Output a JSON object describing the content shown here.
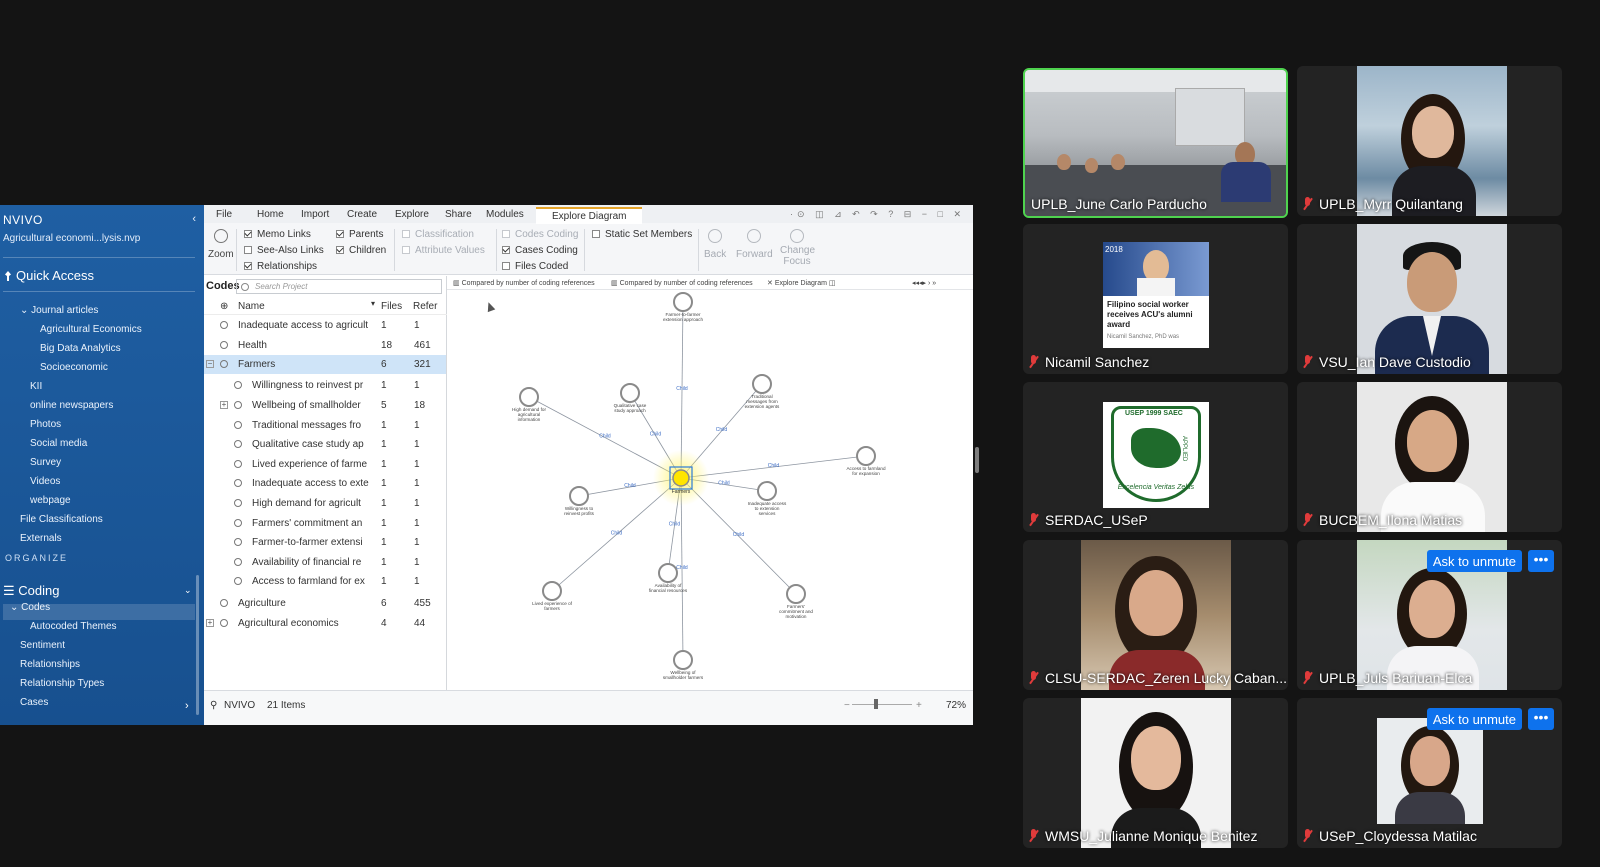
{
  "nvivo": {
    "brand": "NVIVO",
    "project": "Agricultural economi...lysis.nvp",
    "quick_access": "Quick Access",
    "nav_items": [
      {
        "label": "Journal articles",
        "indent": 2,
        "chev": "⌄"
      },
      {
        "label": "Agricultural Economics",
        "indent": 4
      },
      {
        "label": "Big Data Analytics",
        "indent": 4
      },
      {
        "label": "Socioeconomic",
        "indent": 4
      },
      {
        "label": "KII",
        "indent": 3
      },
      {
        "label": "online newspapers",
        "indent": 3
      },
      {
        "label": "Photos",
        "indent": 3
      },
      {
        "label": "Social media",
        "indent": 3
      },
      {
        "label": "Survey",
        "indent": 3
      },
      {
        "label": "Videos",
        "indent": 3
      },
      {
        "label": "webpage",
        "indent": 3
      },
      {
        "label": "File Classifications",
        "indent": 2
      },
      {
        "label": "Externals",
        "indent": 2
      }
    ],
    "organize": "ORGANIZE",
    "coding": "Coding",
    "coding_items": [
      {
        "label": "Codes",
        "indent": 1
      },
      {
        "label": "Autocoded Themes",
        "indent": 3
      },
      {
        "label": "Sentiment",
        "indent": 2
      },
      {
        "label": "Relationships",
        "indent": 2
      },
      {
        "label": "Relationship Types",
        "indent": 2
      },
      {
        "label": "Cases",
        "indent": 2
      }
    ],
    "menus": [
      "File",
      "Home",
      "Import",
      "Create",
      "Explore",
      "Share",
      "Modules"
    ],
    "active_menu": "Explore Diagram",
    "ribbon": {
      "zoom": "Zoom",
      "memo_links": "Memo Links",
      "see_also_links": "See-Also Links",
      "relationships": "Relationships",
      "parents": "Parents",
      "children": "Children",
      "classification": "Classification",
      "attribute_values": "Attribute Values",
      "codes_coding": "Codes Coding",
      "cases_coding": "Cases Coding",
      "files_coded": "Files Coded",
      "static_set_members": "Static Set Members",
      "back": "Back",
      "forward": "Forward",
      "change_focus": "Change Focus"
    },
    "codes_panel": {
      "title": "Codes",
      "search_placeholder": "Search Project",
      "col_name": "Name",
      "col_files": "Files",
      "col_refs": "Refer",
      "rows": [
        {
          "name": "Inadequate access to agricult",
          "files": "1",
          "refs": "1",
          "level": 0
        },
        {
          "name": "Health",
          "files": "18",
          "refs": "461",
          "level": 0
        },
        {
          "name": "Farmers",
          "files": "6",
          "refs": "321",
          "level": 0,
          "selected": true,
          "expanded": true
        },
        {
          "name": "Willingness to reinvest pr",
          "files": "1",
          "refs": "1",
          "level": 1
        },
        {
          "name": "Wellbeing of smallholder",
          "files": "5",
          "refs": "18",
          "level": 1,
          "plus": true
        },
        {
          "name": "Traditional messages fro",
          "files": "1",
          "refs": "1",
          "level": 1
        },
        {
          "name": "Qualitative case study ap",
          "files": "1",
          "refs": "1",
          "level": 1
        },
        {
          "name": "Lived experience of farme",
          "files": "1",
          "refs": "1",
          "level": 1
        },
        {
          "name": "Inadequate access to exte",
          "files": "1",
          "refs": "1",
          "level": 1
        },
        {
          "name": "High demand for agricult",
          "files": "1",
          "refs": "1",
          "level": 1
        },
        {
          "name": "Farmers' commitment an",
          "files": "1",
          "refs": "1",
          "level": 1
        },
        {
          "name": "Farmer-to-farmer extensi",
          "files": "1",
          "refs": "1",
          "level": 1
        },
        {
          "name": "Availability of financial re",
          "files": "1",
          "refs": "1",
          "level": 1
        },
        {
          "name": "Access to farmland for ex",
          "files": "1",
          "refs": "1",
          "level": 1
        },
        {
          "name": "Agriculture",
          "files": "6",
          "refs": "455",
          "level": 0
        },
        {
          "name": "Agricultural economics",
          "files": "4",
          "refs": "44",
          "level": 0,
          "plus": true
        }
      ]
    },
    "diagram_tabs": [
      "Compared by number of coding references",
      "Compared by number of coding references",
      "Explore Diagram"
    ],
    "diagram": {
      "center": "Farmers",
      "edge_label": "Child",
      "nodes": [
        {
          "label": [
            "Farmer-to-farmer",
            "extension approach"
          ]
        },
        {
          "label": [
            "High demand for",
            "agricultural",
            "information"
          ]
        },
        {
          "label": [
            "Qualitative case",
            "study approach"
          ]
        },
        {
          "label": [
            "Traditional",
            "messages from",
            "extension agents"
          ]
        },
        {
          "label": [
            "Access to farmland",
            "for expansion"
          ]
        },
        {
          "label": [
            "Willingness to",
            "reinvest profits"
          ]
        },
        {
          "label": [
            "Inadequate access",
            "to extension",
            "services"
          ]
        },
        {
          "label": [
            "Availability of",
            "financial resources"
          ]
        },
        {
          "label": [
            "Lived experience of",
            "farmers"
          ]
        },
        {
          "label": [
            "Farmers'",
            "commitment and",
            "motivation"
          ]
        },
        {
          "label": [
            "Wellbeing of",
            "smallholder farmers"
          ]
        }
      ]
    },
    "status": {
      "user": "NVIVO",
      "items": "21 Items",
      "zoom": "72%"
    }
  },
  "participants": [
    {
      "name": "UPLB_June Carlo Parducho",
      "muted": false,
      "speaking": true
    },
    {
      "name": "UPLB_Myrr Quilantang",
      "muted": true
    },
    {
      "name": "Nicamil Sanchez",
      "muted": true,
      "thumbnail_caption": "Filipino social worker receives ACU's alumni award",
      "thumbnail_sub": "Nicamil Sanchez, PhD was",
      "thumbnail_tag": "2018"
    },
    {
      "name": "VSU_Ian Dave Custodio",
      "muted": true
    },
    {
      "name": "SERDAC_USeP",
      "muted": true,
      "logo_text": "USEP 1999 SAEC",
      "motto": "Excelencia Veritas Zelus",
      "logo_side": "APPLIED"
    },
    {
      "name": "BUCBEM_Ilona Matias",
      "muted": true
    },
    {
      "name": "CLSU-SERDAC_Zeren Lucky Caban...",
      "muted": true
    },
    {
      "name": "UPLB_Juls Bariuan-Elca",
      "muted": true,
      "ask_unmute": "Ask to unmute"
    },
    {
      "name": "WMSU_Julianne Monique Benitez",
      "muted": true
    },
    {
      "name": "USeP_Cloydessa Matilac",
      "muted": true,
      "ask_unmute": "Ask to unmute"
    }
  ],
  "more_glyph": "•••",
  "colors": {
    "speaking_border": "#4fd34f",
    "nvivo_nav": "#1f5fa3",
    "zoom_blue": "#0e72ed",
    "muted_red": "#e03b3b"
  }
}
